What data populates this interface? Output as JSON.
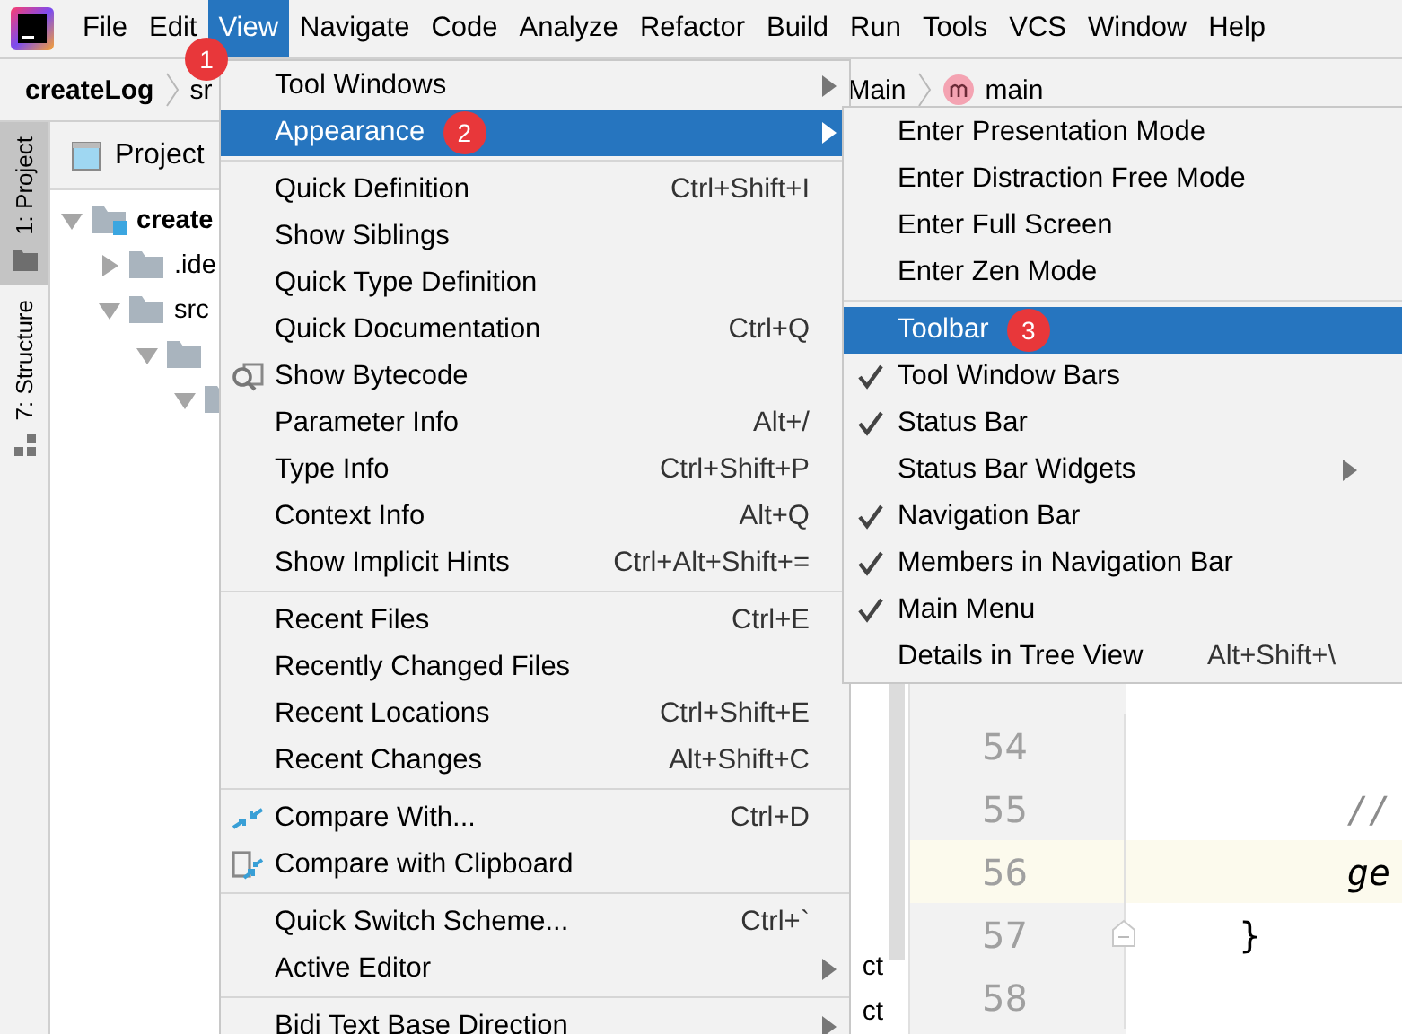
{
  "menubar": [
    {
      "label": "File",
      "selected": false
    },
    {
      "label": "Edit",
      "selected": false
    },
    {
      "label": "View",
      "selected": true,
      "badge": "1"
    },
    {
      "label": "Navigate",
      "selected": false
    },
    {
      "label": "Code",
      "selected": false
    },
    {
      "label": "Analyze",
      "selected": false
    },
    {
      "label": "Refactor",
      "selected": false
    },
    {
      "label": "Build",
      "selected": false
    },
    {
      "label": "Run",
      "selected": false
    },
    {
      "label": "Tools",
      "selected": false
    },
    {
      "label": "VCS",
      "selected": false
    },
    {
      "label": "Window",
      "selected": false
    },
    {
      "label": "Help",
      "selected": false
    }
  ],
  "navbar": {
    "left": [
      {
        "label": "createLog",
        "bold": true
      },
      {
        "label": "sr",
        "bold": false
      }
    ],
    "right": [
      {
        "label": "Main",
        "method": false
      },
      {
        "label": "main",
        "method": true
      }
    ]
  },
  "side_tabs": [
    {
      "label": "1: Project",
      "selected": true
    },
    {
      "label": "7: Structure",
      "selected": false
    }
  ],
  "project_panel": {
    "title": "Project",
    "tree": [
      {
        "label": "create",
        "bold": true,
        "expanded": true,
        "children": [
          {
            "label": ".ide",
            "expanded": false
          },
          {
            "label": "src",
            "expanded": true,
            "children": [
              {
                "expanded": true,
                "children": [
                  {
                    "expanded": true
                  }
                ]
              }
            ]
          }
        ]
      }
    ],
    "cut_rows": [
      "ct",
      "ct"
    ]
  },
  "editor": {
    "lines": [
      {
        "number": "54",
        "current": false
      },
      {
        "number": "55",
        "code": "          //",
        "kind": "comment",
        "current": false
      },
      {
        "number": "56",
        "code": "          ge",
        "kind": "italic",
        "current": true
      },
      {
        "number": "57",
        "code": "     }",
        "kind": "plain",
        "current": false,
        "fold": true
      },
      {
        "number": "58",
        "current": false
      }
    ]
  },
  "view_menu": [
    {
      "kind": "item",
      "label": "Tool Windows",
      "submenu": true,
      "selected": false
    },
    {
      "kind": "item",
      "label": "Appearance",
      "submenu": true,
      "selected": true,
      "badge": "2"
    },
    {
      "kind": "separator"
    },
    {
      "kind": "item",
      "label": "Quick Definition",
      "shortcut": "Ctrl+Shift+I",
      "selected": false
    },
    {
      "kind": "item",
      "label": "Show Siblings",
      "selected": false
    },
    {
      "kind": "item",
      "label": "Quick Type Definition",
      "selected": false
    },
    {
      "kind": "item",
      "label": "Quick Documentation",
      "shortcut": "Ctrl+Q",
      "selected": false
    },
    {
      "kind": "item",
      "label": "Show Bytecode",
      "selected": false
    },
    {
      "kind": "item",
      "label": "Parameter Info",
      "shortcut": "Alt+/",
      "selected": false
    },
    {
      "kind": "item",
      "label": "Type Info",
      "shortcut": "Ctrl+Shift+P",
      "selected": false
    },
    {
      "kind": "item",
      "label": "Context Info",
      "shortcut": "Alt+Q",
      "selected": false
    },
    {
      "kind": "item",
      "label": "Show Implicit Hints",
      "shortcut": "Ctrl+Alt+Shift+=",
      "selected": false
    },
    {
      "kind": "separator"
    },
    {
      "kind": "item",
      "label": "Recent Files",
      "shortcut": "Ctrl+E",
      "selected": false
    },
    {
      "kind": "item",
      "label": "Recently Changed Files",
      "selected": false
    },
    {
      "kind": "item",
      "label": "Recent Locations",
      "shortcut": "Ctrl+Shift+E",
      "selected": false
    },
    {
      "kind": "item",
      "label": "Recent Changes",
      "shortcut": "Alt+Shift+C",
      "selected": false
    },
    {
      "kind": "separator"
    },
    {
      "kind": "item",
      "label": "Compare With...",
      "shortcut": "Ctrl+D",
      "selected": false
    },
    {
      "kind": "item",
      "label": "Compare with Clipboard",
      "selected": false
    },
    {
      "kind": "separator"
    },
    {
      "kind": "item",
      "label": "Quick Switch Scheme...",
      "shortcut": "Ctrl+`",
      "selected": false
    },
    {
      "kind": "item",
      "label": "Active Editor",
      "submenu": true,
      "selected": false
    },
    {
      "kind": "separator"
    },
    {
      "kind": "item",
      "label": "Bidi Text Base Direction",
      "submenu": true,
      "selected": false
    }
  ],
  "appearance_menu": [
    {
      "kind": "item",
      "label": "Enter Presentation Mode",
      "selected": false
    },
    {
      "kind": "item",
      "label": "Enter Distraction Free Mode",
      "selected": false
    },
    {
      "kind": "item",
      "label": "Enter Full Screen",
      "selected": false
    },
    {
      "kind": "item",
      "label": "Enter Zen Mode",
      "selected": false
    },
    {
      "kind": "separator"
    },
    {
      "kind": "item",
      "label": "Toolbar",
      "checked": false,
      "selected": true,
      "badge": "3"
    },
    {
      "kind": "item",
      "label": "Tool Window Bars",
      "checked": true,
      "selected": false
    },
    {
      "kind": "item",
      "label": "Status Bar",
      "checked": true,
      "selected": false
    },
    {
      "kind": "item",
      "label": "Status Bar Widgets",
      "checked": false,
      "submenu": true,
      "selected": false
    },
    {
      "kind": "item",
      "label": "Navigation Bar",
      "checked": true,
      "selected": false
    },
    {
      "kind": "item",
      "label": "Members in Navigation Bar",
      "checked": true,
      "selected": false
    },
    {
      "kind": "item",
      "label": "Main Menu",
      "checked": true,
      "selected": false
    },
    {
      "kind": "item",
      "label": "Details in Tree View",
      "shortcut": "Alt+Shift+\\",
      "checked": false,
      "selected": false
    }
  ]
}
